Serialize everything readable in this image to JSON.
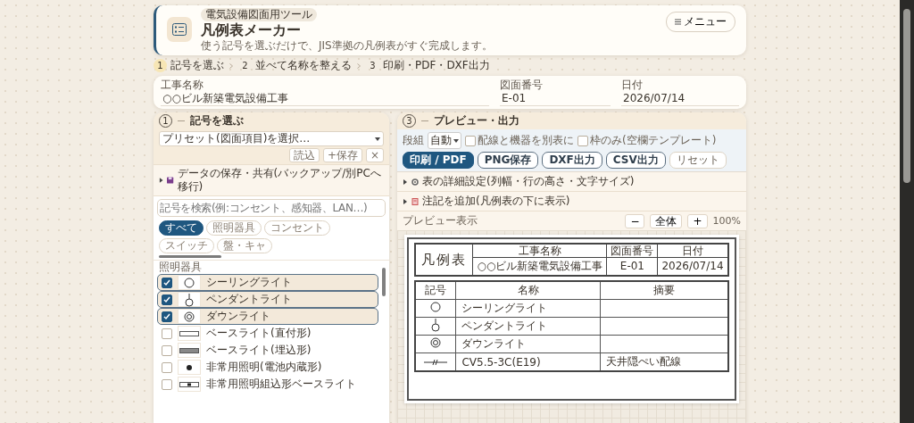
{
  "header": {
    "badge": "電気設備図面用ツール",
    "title": "凡例表メーカー",
    "subtitle": "使う記号を選ぶだけで、JIS準拠の凡例表がすぐ完成します。",
    "menu_button": "メニュー"
  },
  "steps": [
    {
      "number": "1",
      "label": "記号を選ぶ",
      "selected": true
    },
    {
      "number": "2",
      "label": "並べて名称を整える",
      "selected": false
    },
    {
      "number": "3",
      "label": "印刷・PDF・DXF出力",
      "selected": false
    }
  ],
  "project": [
    {
      "label": "工事名称",
      "value": "○○ビル新築電気設備工事"
    },
    {
      "label": "図面番号",
      "value": "E-01"
    },
    {
      "label": "日付",
      "value": "2026/07/14"
    }
  ],
  "left_panel": {
    "number": "1",
    "title": "記号を選ぶ",
    "preset": "プリセット(図面項目)を選択…",
    "buttons": [
      "読込",
      "+保存",
      "×"
    ],
    "data_section": {
      "label": "データの保存・共有(バックアップ/別PCへ移行)",
      "expanded": false
    },
    "search_placeholder": "記号を検索(例:コンセント、感知器、LAN…)",
    "filters": [
      {
        "label": "すべて",
        "selected": true
      },
      {
        "label": "照明器具",
        "selected": false
      },
      {
        "label": "コンセント",
        "selected": false
      },
      {
        "label": "スイッチ",
        "selected": false
      },
      {
        "label": "盤・キャ",
        "selected": false
      }
    ],
    "category": "照明器具",
    "items": [
      {
        "name": "シーリングライト",
        "kind": "ceiling",
        "checked": true
      },
      {
        "name": "ペンダントライト",
        "kind": "pendant",
        "checked": true
      },
      {
        "name": "ダウンライト",
        "kind": "downlight",
        "checked": true
      },
      {
        "name": "ベースライト(直付形)",
        "kind": "base-surface",
        "checked": false
      },
      {
        "name": "ベースライト(埋込形)",
        "kind": "base-embedded",
        "checked": false
      },
      {
        "name": "非常用照明(電池内蔵形)",
        "kind": "emergency",
        "checked": false
      },
      {
        "name": "非常用照明組込形ベースライト",
        "kind": "emergency-base",
        "checked": false
      }
    ]
  },
  "right_panel": {
    "number": "3",
    "title": "プレビュー・出力",
    "layout_label": "段組",
    "layout_value": "自動",
    "checkboxes": [
      {
        "label": "配線と機器を別表に",
        "checked": false
      },
      {
        "label": "枠のみ(空欄テンプレート)",
        "checked": false
      }
    ],
    "buttons": [
      {
        "label": "印刷 / PDF",
        "primary": true
      },
      {
        "label": "PNG保存",
        "primary": false
      },
      {
        "label": "DXF出力",
        "primary": false
      },
      {
        "label": "CSV出力",
        "primary": false
      },
      {
        "label": "リセット",
        "primary": false
      }
    ],
    "sections": [
      {
        "label": "表の詳細設定(列幅・行の高さ・文字サイズ)",
        "expanded": false
      },
      {
        "label": "注記を追加(凡例表の下に表示)",
        "expanded": false
      }
    ],
    "preview_label": "プレビュー表示",
    "zoom_buttons": [
      "−",
      "全体",
      "+"
    ],
    "zoom": "100%"
  },
  "legend": {
    "title": "凡例表",
    "header": [
      {
        "label": "工事名称",
        "value": "○○ビル新築電気設備工事"
      },
      {
        "label": "図面番号",
        "value": "E-01"
      },
      {
        "label": "日付",
        "value": "2026/07/14"
      }
    ],
    "columns": [
      "記号",
      "名称",
      "摘要"
    ],
    "rows": [
      {
        "kind": "ceiling",
        "name": "シーリングライト"
      },
      {
        "kind": "pendant",
        "name": "ペンダントライト"
      },
      {
        "kind": "downlight",
        "name": "ダウンライト"
      },
      {
        "kind": "cable",
        "name": "CV5.5-3C(E19)",
        "note": "天井隠ぺい配線"
      }
    ]
  }
}
